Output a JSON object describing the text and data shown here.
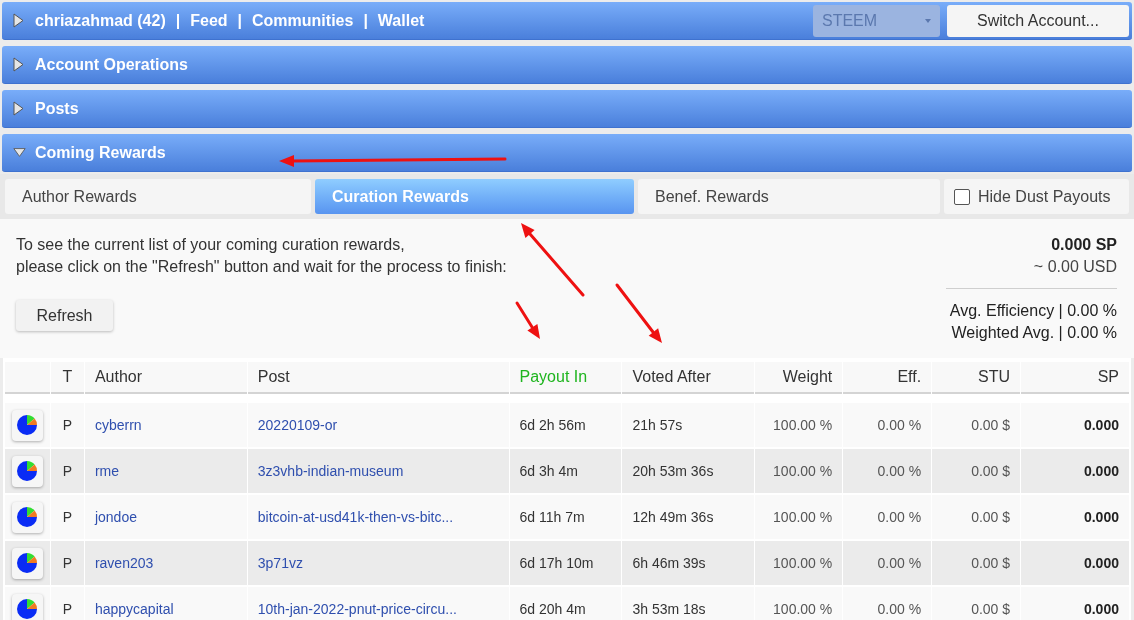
{
  "header_bar": {
    "expanded": false,
    "links": [
      "chriazahmad (42)",
      "Feed",
      "Communities",
      "Wallet"
    ],
    "separators": [
      "|",
      "|",
      "|"
    ],
    "currency_select": {
      "value": "STEEM",
      "disabled": true
    },
    "switch_account_button": "Switch Account..."
  },
  "sections": [
    {
      "title": "Account Operations",
      "expanded": false
    },
    {
      "title": "Posts",
      "expanded": false
    },
    {
      "title": "Coming Rewards",
      "expanded": true
    }
  ],
  "reward_tabs": [
    {
      "label": "Author Rewards",
      "selected": false
    },
    {
      "label": "Curation Rewards",
      "selected": true
    },
    {
      "label": "Benef. Rewards",
      "selected": false
    }
  ],
  "hide_dust_payouts": {
    "label": "Hide Dust Payouts",
    "checked": false
  },
  "instructions": [
    "To see the current list of your coming curation rewards,",
    "please click on the \"Refresh\" button and wait for the process to finish:"
  ],
  "refresh_button": "Refresh",
  "totals": {
    "sp": "0.000 SP",
    "usd": "~ 0.00 USD",
    "avg_efficiency": "Avg. Efficiency | 0.00 %",
    "weighted_avg": "Weighted Avg. | 0.00 %"
  },
  "table": {
    "columns": [
      {
        "label": "T",
        "highlighted": false
      },
      {
        "label": "Author",
        "highlighted": false
      },
      {
        "label": "Post",
        "highlighted": false
      },
      {
        "label": "Payout In",
        "highlighted": true
      },
      {
        "label": "Voted After",
        "highlighted": false
      },
      {
        "label": "Weight",
        "highlighted": false
      },
      {
        "label": "Eff.",
        "highlighted": false
      },
      {
        "label": "STU",
        "highlighted": false
      },
      {
        "label": "SP",
        "highlighted": false
      }
    ],
    "rows": [
      {
        "type": "P",
        "author": "cyberrn",
        "post": "20220109-or",
        "payout_in": "6d 2h 56m",
        "voted_after": "21h 57s",
        "weight": "100.00 %",
        "eff": "0.00 %",
        "stu": "0.00 $",
        "sp": "0.000"
      },
      {
        "type": "P",
        "author": "rme",
        "post": "3z3vhb-indian-museum",
        "payout_in": "6d 3h 4m",
        "voted_after": "20h 53m 36s",
        "weight": "100.00 %",
        "eff": "0.00 %",
        "stu": "0.00 $",
        "sp": "0.000"
      },
      {
        "type": "P",
        "author": "jondoe",
        "post": "bitcoin-at-usd41k-then-vs-bitc...",
        "payout_in": "6d 11h 7m",
        "voted_after": "12h 49m 36s",
        "weight": "100.00 %",
        "eff": "0.00 %",
        "stu": "0.00 $",
        "sp": "0.000"
      },
      {
        "type": "P",
        "author": "raven203",
        "post": "3p71vz",
        "payout_in": "6d 17h 10m",
        "voted_after": "6h 46m 39s",
        "weight": "100.00 %",
        "eff": "0.00 %",
        "stu": "0.00 $",
        "sp": "0.000"
      },
      {
        "type": "P",
        "author": "happycapital",
        "post": "10th-jan-2022-pnut-price-circu...",
        "payout_in": "6d 20h 4m",
        "voted_after": "3h 53m 18s",
        "weight": "100.00 %",
        "eff": "0.00 %",
        "stu": "0.00 $",
        "sp": "0.000"
      }
    ]
  },
  "annotations": [
    {
      "kind": "arrow"
    },
    {
      "kind": "arrow"
    },
    {
      "kind": "arrow"
    },
    {
      "kind": "arrow"
    }
  ]
}
